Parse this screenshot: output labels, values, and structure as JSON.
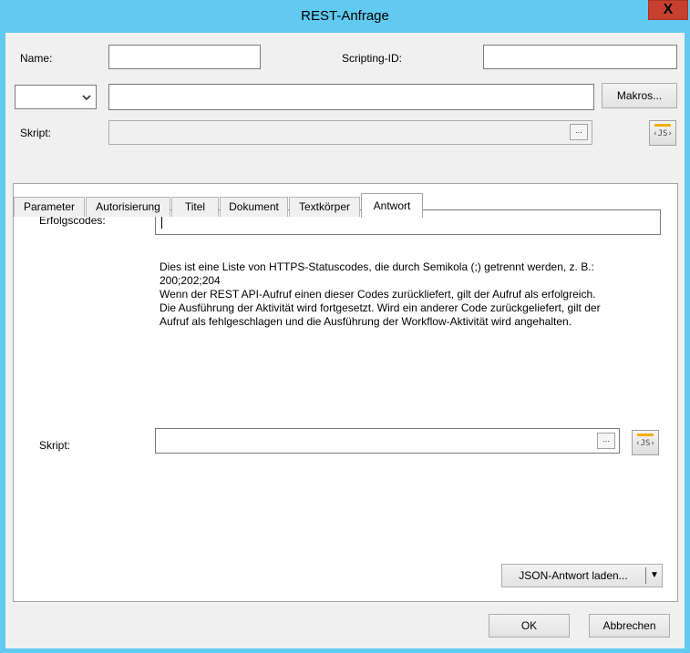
{
  "window": {
    "title": "REST-Anfrage",
    "close_glyph": "X"
  },
  "form": {
    "name_label": "Name:",
    "name_value": "",
    "scripting_id_label": "Scripting-ID:",
    "scripting_id_value": "",
    "method_selected": "",
    "url_value": "",
    "macros_button": "Makros...",
    "script_label": "Skript:",
    "browse_glyph": "...",
    "js_glyph": "‹JS›"
  },
  "tabs": [
    {
      "label": "Parameter"
    },
    {
      "label": "Autorisierung"
    },
    {
      "label": "Titel"
    },
    {
      "label": "Dokument"
    },
    {
      "label": "Textkörper"
    },
    {
      "label": "Antwort"
    }
  ],
  "response_tab": {
    "success_codes_label": "Erfolgscodes:",
    "success_codes_value": "",
    "description_lines": [
      "Dies ist eine Liste von HTTPS-Statuscodes, die durch Semikola (;) getrennt werden, z. B.:",
      "200;202;204",
      "Wenn der REST API-Aufruf einen dieser Codes zurückliefert, gilt der Aufruf als erfolgreich.",
      "Die Ausführung der Aktivität wird fortgesetzt. Wird ein anderer Code zurückgeliefert, gilt der",
      "Aufruf als fehlgeschlagen und die Ausführung der Workflow-Aktivität wird angehalten."
    ],
    "script_label": "Skript:",
    "load_json_button": "JSON-Antwort laden...",
    "dropdown_glyph": "▼"
  },
  "footer": {
    "ok_button": "OK",
    "cancel_button": "Abbrechen"
  }
}
